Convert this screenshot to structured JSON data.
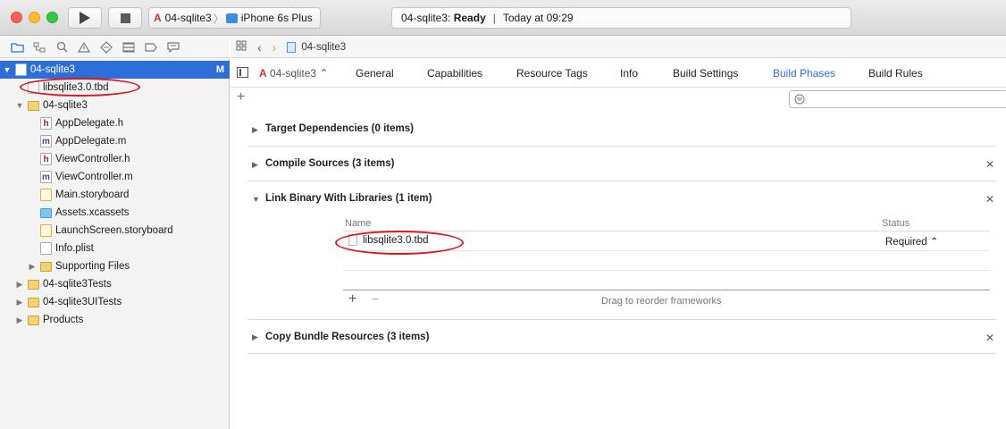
{
  "toolbar": {
    "scheme_project": "04-sqlite3",
    "scheme_device": "iPhone 6s Plus",
    "activity_project": "04-sqlite3:",
    "activity_status": "Ready",
    "activity_time": "Today at 09:29"
  },
  "navigator": {
    "project": "04-sqlite3",
    "project_badge": "M",
    "items": [
      {
        "label": "libsqlite3.0.tbd"
      },
      {
        "label": "04-sqlite3"
      },
      {
        "label": "AppDelegate.h",
        "glyph": "h"
      },
      {
        "label": "AppDelegate.m",
        "glyph": "m"
      },
      {
        "label": "ViewController.h",
        "glyph": "h"
      },
      {
        "label": "ViewController.m",
        "glyph": "m"
      },
      {
        "label": "Main.storyboard"
      },
      {
        "label": "Assets.xcassets"
      },
      {
        "label": "LaunchScreen.storyboard"
      },
      {
        "label": "Info.plist"
      },
      {
        "label": "Supporting Files"
      },
      {
        "label": "04-sqlite3Tests"
      },
      {
        "label": "04-sqlite3UITests"
      },
      {
        "label": "Products"
      }
    ]
  },
  "jumpbar": {
    "file": "04-sqlite3"
  },
  "tabs": {
    "target": "04-sqlite3",
    "general": "General",
    "capabilities": "Capabilities",
    "resource_tags": "Resource Tags",
    "info": "Info",
    "build_settings": "Build Settings",
    "build_phases": "Build Phases",
    "build_rules": "Build Rules"
  },
  "phases": {
    "target_deps": "Target Dependencies (0 items)",
    "compile_sources": "Compile Sources (3 items)",
    "link_binary": "Link Binary With Libraries (1 item)",
    "copy_bundle": "Copy Bundle Resources (3 items)"
  },
  "lib_table": {
    "col_name": "Name",
    "col_status": "Status",
    "rows": [
      {
        "name": "libsqlite3.0.tbd",
        "status": "Required"
      }
    ],
    "hint": "Drag to reorder frameworks"
  },
  "colors": {
    "accent": "#2f6fe3",
    "selection": "#2d6fd6",
    "annotation": "#e0151b"
  },
  "icons": [
    "run-icon",
    "stop-icon",
    "folder-icon",
    "search-icon",
    "warning-icon",
    "close-icon",
    "plus-icon",
    "minus-icon"
  ]
}
